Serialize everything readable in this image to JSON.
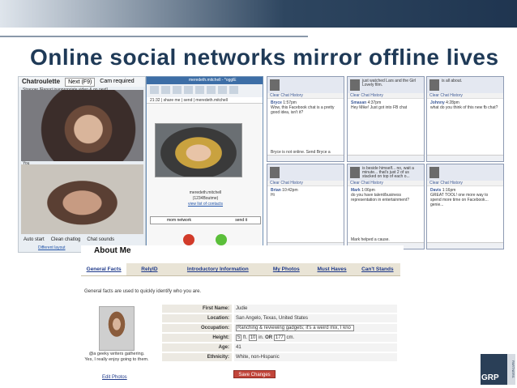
{
  "slide": {
    "title": "Online social networks mirror offline lives"
  },
  "chatroulette": {
    "logo": "Chatroulette",
    "next_button": "Next (F9)",
    "cam_label": "Cam required",
    "stranger_label": "Stranger [Report inappropriate video & go next]",
    "you_label": "You",
    "auto_start": "Auto start",
    "clean_chatlog": "Clean chatlog",
    "chat_sounds": "Chat sounds",
    "different_layout": "Different layout"
  },
  "video_chat": {
    "title": "meredeth.mitchell - *ogglE",
    "tools": [
      "bind",
      "pot",
      "spot",
      "ad",
      "cap",
      "contacts",
      "contrl",
      "record"
    ],
    "address": "21:32 | share me | send | meredeth.mitchell",
    "name": "meredeth.mitchell",
    "status": "(1234Boutme)",
    "link": "view list of contacts",
    "input_value": "mom network",
    "send_label": "send it"
  },
  "fb_chats": [
    {
      "header": "",
      "bar": "Clear Chat History",
      "sender": "Bryce",
      "time": "1:57pm",
      "text": "Wow, this Facebook chat is a pretty good idea, isn't it?",
      "footer": "Bryce is not online. Send Bryce a Message"
    },
    {
      "header": "just watched Lars and the Girl Lovely film.",
      "bar": "Clear Chat History",
      "sender": "Smasan",
      "time": "4:37pm",
      "text": "Hey Mike! Just got into FB chat",
      "footer": ""
    },
    {
      "header": "is all about.",
      "bar": "Clear Chat History",
      "sender": "Johnny",
      "time": "4:28pm",
      "text": "what do you think of this new fb chat?",
      "footer": ""
    },
    {
      "header": "",
      "bar": "Clear Chat History",
      "sender": "Brian",
      "time": "10:42pm",
      "text": "Hi",
      "footer": ""
    },
    {
      "header": "is beside himself... no, wait a minute... that's just 2 of us stacked on top of each o...",
      "bar": "Clear Chat History",
      "sender": "Mark",
      "time": "1:06pm",
      "text": "do you have talent/business representation in entertainment?",
      "footer": "Mark helped a cause."
    },
    {
      "header": "",
      "bar": "Clear Chat History",
      "sender": "Davis",
      "time": "1:16pm",
      "text": "GREAT TOOL! one more way to spend more time on Facebook... genie...",
      "footer": ""
    }
  ],
  "about_me": {
    "title": "About Me",
    "tabs": [
      "General Facts",
      "RelyID",
      "Introductory Information",
      "My Photos",
      "Must Haves",
      "Can't Stands"
    ],
    "description": "General facts are used to quickly identify who you are.",
    "caption": "@a geeky writers gathering. Yes, I really enjoy going to them.",
    "edit_photos": "Edit Photos",
    "fields": {
      "first_name_label": "First Name:",
      "first_name": "Judie",
      "location_label": "Location:",
      "location": "San Angelo, Texas, United States",
      "occupation_label": "Occupation:",
      "occupation": "Ranching & reviewing gadgets; it's a weird mix, I kno",
      "height_label": "Height:",
      "height_ft": "5",
      "ft": "ft.",
      "height_in": "10",
      "in": "in.",
      "or": "OR",
      "height_cm": "177",
      "cm": "cm.",
      "age_label": "Age:",
      "age": "41",
      "ethnicity_label": "Ethnicity:",
      "ethnicity": "White, non-Hispanic"
    },
    "save_button": "Save Changes"
  },
  "logo": {
    "text": "GRP",
    "side": "PARTNERS"
  }
}
